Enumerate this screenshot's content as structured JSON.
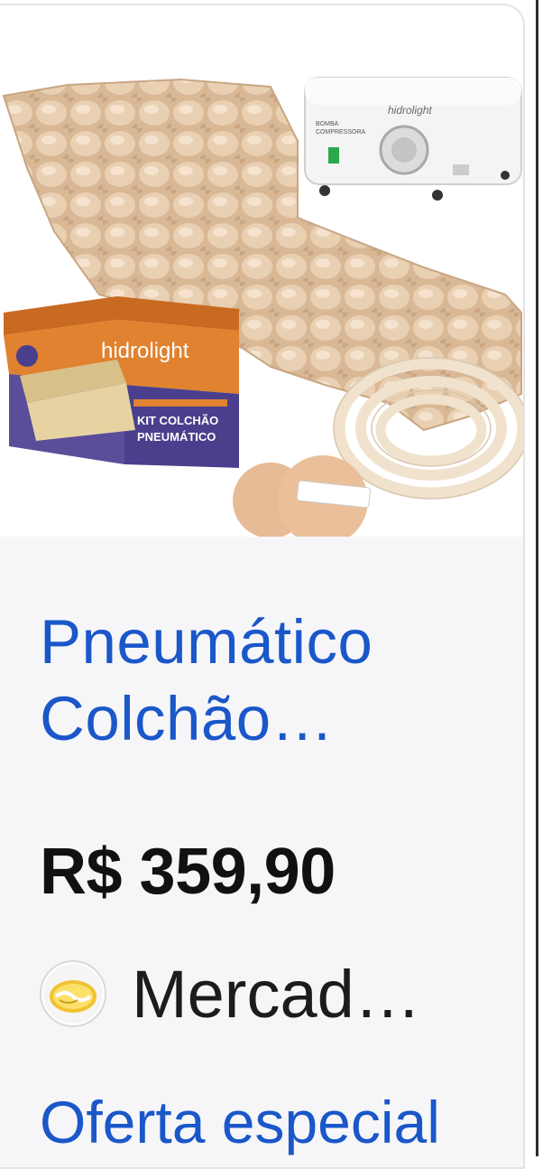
{
  "product": {
    "image": {
      "pump_brand": "hidrolight",
      "pump_label_line1": "BOMBA",
      "pump_label_line2": "COMPRESSORA",
      "box_brand": "hidrolight",
      "box_label_line1": "KIT COLCHÃO",
      "box_label_line2": "PNEUMÁTICO"
    },
    "title_line1": "Pneumático",
    "title_line2": "Colchão…",
    "price": "R$ 359,90",
    "seller": "Mercad…",
    "offer": "Oferta especial"
  },
  "colors": {
    "link": "#1a57c9",
    "price": "#111111",
    "mattress": "#e3c4a4",
    "box_orange": "#d9782a",
    "box_purple": "#4a3f8c"
  }
}
